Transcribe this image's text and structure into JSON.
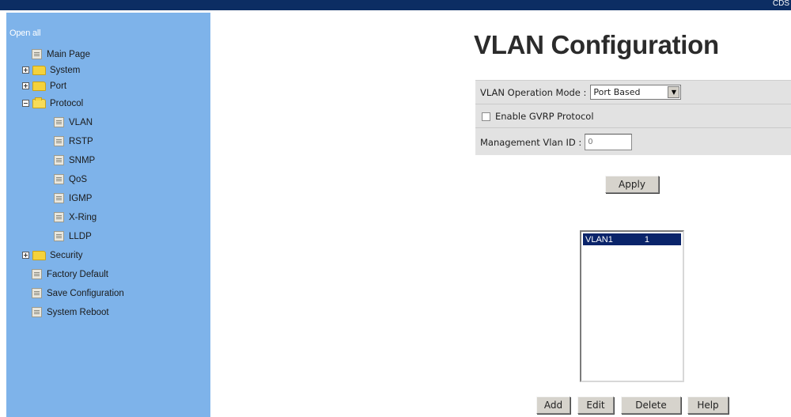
{
  "header": {
    "corner_text": "CDS"
  },
  "sidebar": {
    "open_all": "Open all",
    "items": [
      {
        "label": "Main Page",
        "type": "page",
        "level": 0
      },
      {
        "label": "System",
        "type": "folder",
        "state": "collapsed",
        "level": 0
      },
      {
        "label": "Port",
        "type": "folder",
        "state": "collapsed",
        "level": 0
      },
      {
        "label": "Protocol",
        "type": "folder",
        "state": "expanded",
        "level": 0
      },
      {
        "label": "VLAN",
        "type": "page",
        "level": 1
      },
      {
        "label": "RSTP",
        "type": "page",
        "level": 1
      },
      {
        "label": "SNMP",
        "type": "page",
        "level": 1
      },
      {
        "label": "QoS",
        "type": "page",
        "level": 1
      },
      {
        "label": "IGMP",
        "type": "page",
        "level": 1
      },
      {
        "label": "X-Ring",
        "type": "page",
        "level": 1
      },
      {
        "label": "LLDP",
        "type": "page",
        "level": 1
      },
      {
        "label": "Security",
        "type": "folder",
        "state": "collapsed",
        "level": 0
      },
      {
        "label": "Factory Default",
        "type": "page",
        "level": 0
      },
      {
        "label": "Save Configuration",
        "type": "page",
        "level": 0
      },
      {
        "label": "System Reboot",
        "type": "page",
        "level": 0
      }
    ]
  },
  "main": {
    "title": "VLAN Configuration",
    "operation_mode": {
      "label": "VLAN Operation Mode :",
      "selected": "Port Based"
    },
    "gvrp": {
      "label": "Enable GVRP Protocol",
      "checked": false
    },
    "mgmt_vlan": {
      "label": "Management Vlan ID :",
      "value": "0"
    },
    "apply_label": "Apply",
    "vlan_list": [
      {
        "name": "VLAN1",
        "id": "1"
      }
    ],
    "buttons": {
      "add": "Add",
      "edit": "Edit",
      "delete": "Delete",
      "help": "Help"
    }
  },
  "colors": {
    "top_bar": "#0c2d63",
    "sidebar_bg": "#7eb3ea",
    "list_selection": "#0a246a",
    "form_bg": "#e2e2e2"
  },
  "icons": {
    "tree_page": "page-icon",
    "tree_folder": "folder-icon",
    "expander": "plus-minus-icon",
    "dropdown": "chevron-down-icon"
  }
}
